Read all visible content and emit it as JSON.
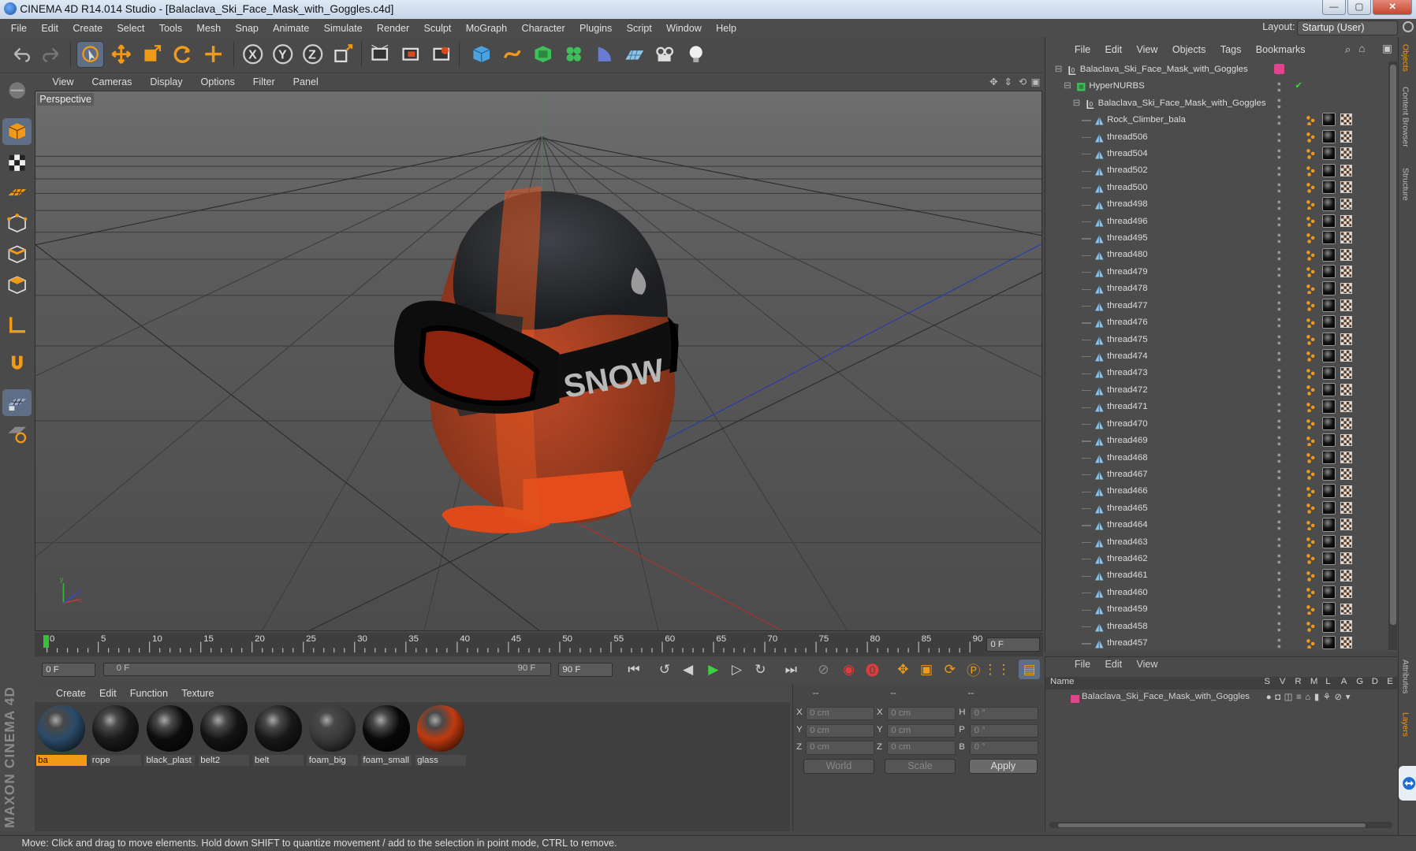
{
  "app": {
    "title": "CINEMA 4D R14.014 Studio - [Balaclava_Ski_Face_Mask_with_Goggles.c4d]",
    "layout_label": "Layout:",
    "layout_value": "Startup (User)"
  },
  "menu": [
    "File",
    "Edit",
    "Create",
    "Select",
    "Tools",
    "Mesh",
    "Snap",
    "Animate",
    "Simulate",
    "Render",
    "Sculpt",
    "MoGraph",
    "Character",
    "Plugins",
    "Script",
    "Window",
    "Help"
  ],
  "viewport": {
    "menu": [
      "View",
      "Cameras",
      "Display",
      "Options",
      "Filter",
      "Panel"
    ],
    "label": "Perspective",
    "goggle_strap_text": "SNOW"
  },
  "timeline": {
    "ticks": [
      "0",
      "5",
      "10",
      "15",
      "20",
      "25",
      "30",
      "35",
      "40",
      "45",
      "50",
      "55",
      "60",
      "65",
      "70",
      "75",
      "80",
      "85",
      "90"
    ],
    "current_frame": "0 F",
    "start_field": "0 F",
    "range_start": "0 F",
    "range_end": "90 F",
    "end_field": "90 F"
  },
  "materials": {
    "menu": [
      "Create",
      "Edit",
      "Function",
      "Texture"
    ],
    "items": [
      {
        "name": "ba",
        "color": "#2a4b6a"
      },
      {
        "name": "rope",
        "color": "#1a1a1a"
      },
      {
        "name": "black_plast",
        "color": "#0d0d0d"
      },
      {
        "name": "belt2",
        "color": "#141414"
      },
      {
        "name": "belt",
        "color": "#181818"
      },
      {
        "name": "foam_big",
        "color": "#3a3a3a"
      },
      {
        "name": "foam_small",
        "color": "#080808"
      },
      {
        "name": "glass",
        "color": "#c03a10"
      }
    ]
  },
  "coords": {
    "headers": [
      "--",
      "--",
      "--"
    ],
    "rows": [
      {
        "a": "X",
        "av": "0 cm",
        "b": "X",
        "bv": "0 cm",
        "c": "H",
        "cv": "0 °"
      },
      {
        "a": "Y",
        "av": "0 cm",
        "b": "Y",
        "bv": "0 cm",
        "c": "P",
        "cv": "0 °"
      },
      {
        "a": "Z",
        "av": "0 cm",
        "b": "Z",
        "bv": "0 cm",
        "c": "B",
        "cv": "0 °"
      }
    ],
    "mode1": "World",
    "mode2": "Scale",
    "apply": "Apply"
  },
  "objects": {
    "menu": [
      "File",
      "Edit",
      "View",
      "Objects",
      "Tags",
      "Bookmarks"
    ],
    "root": "Balaclava_Ski_Face_Mask_with_Goggles",
    "hypernurbs": "HyperNURBS",
    "group": "Balaclava_Ski_Face_Mask_with_Goggles",
    "items": [
      "Rock_Climber_bala",
      "thread506",
      "thread504",
      "thread502",
      "thread500",
      "thread498",
      "thread496",
      "thread495",
      "thread480",
      "thread479",
      "thread478",
      "thread477",
      "thread476",
      "thread475",
      "thread474",
      "thread473",
      "thread472",
      "thread471",
      "thread470",
      "thread469",
      "thread468",
      "thread467",
      "thread466",
      "thread465",
      "thread464",
      "thread463",
      "thread462",
      "thread461",
      "thread460",
      "thread459",
      "thread458",
      "thread457"
    ]
  },
  "attributes": {
    "menu": [
      "File",
      "Edit",
      "View"
    ],
    "columns": [
      "Name",
      "S",
      "V",
      "R",
      "M",
      "L",
      "A",
      "G",
      "D",
      "E"
    ],
    "layer_name": "Balaclava_Ski_Face_Mask_with_Goggles"
  },
  "right_tabs": [
    "Objects",
    "Content Browser",
    "Structure",
    "Attributes",
    "Layers"
  ],
  "status": "Move: Click and drag to move elements. Hold down SHIFT to quantize movement / add to the selection in point mode, CTRL to remove.",
  "colors": {
    "accent": "#f09a17",
    "selected": "#5e6e86",
    "mask_orange": "#d84a1a"
  }
}
